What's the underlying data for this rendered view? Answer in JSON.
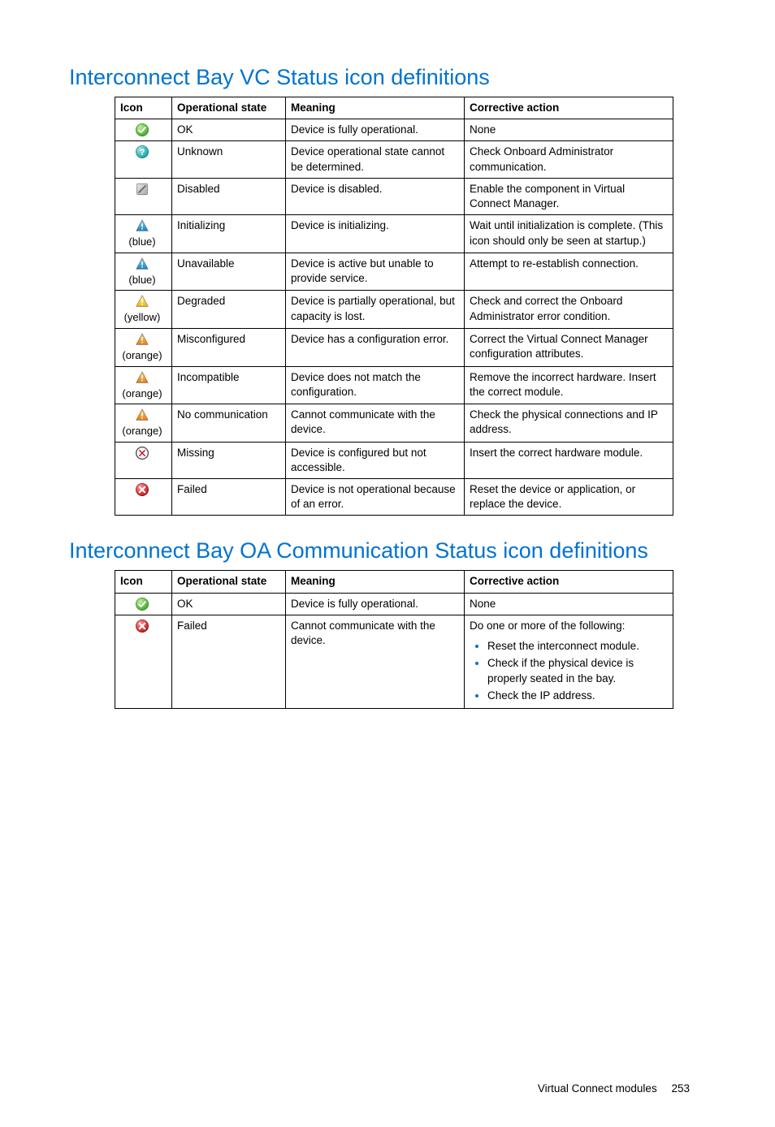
{
  "headings": {
    "vc": "Interconnect Bay VC Status icon definitions",
    "oa": "Interconnect Bay OA Communication Status icon definitions"
  },
  "columns": {
    "icon": "Icon",
    "state": "Operational state",
    "meaning": "Meaning",
    "action": "Corrective action"
  },
  "icon_labels": {
    "blue": "(blue)",
    "yellow": "(yellow)",
    "orange": "(orange)"
  },
  "vc_rows": [
    {
      "icon": "ok",
      "label": "",
      "state": "OK",
      "meaning": "Device is fully operational.",
      "action": "None"
    },
    {
      "icon": "unknown",
      "label": "",
      "state": "Unknown",
      "meaning": "Device operational state cannot be determined.",
      "action": "Check Onboard Administrator communication."
    },
    {
      "icon": "disabled",
      "label": "",
      "state": "Disabled",
      "meaning": "Device is disabled.",
      "action": "Enable the component in Virtual Connect Manager."
    },
    {
      "icon": "warn-blue",
      "label": "blue",
      "state": "Initializing",
      "meaning": "Device is initializing.",
      "action": "Wait until initialization is complete. (This icon should only be seen at startup.)"
    },
    {
      "icon": "warn-blue",
      "label": "blue",
      "state": "Unavailable",
      "meaning": "Device is active but unable to provide service.",
      "action": "Attempt to re-establish connection."
    },
    {
      "icon": "warn-yellow",
      "label": "yellow",
      "state": "Degraded",
      "meaning": "Device is partially operational, but capacity is lost.",
      "action": "Check and correct the Onboard Administrator error condition."
    },
    {
      "icon": "warn-orange",
      "label": "orange",
      "state": "Misconfigured",
      "meaning": "Device has a configuration error.",
      "action": "Correct the Virtual Connect Manager configuration attributes."
    },
    {
      "icon": "warn-orange",
      "label": "orange",
      "state": "Incompatible",
      "meaning": "Device does not match the configuration.",
      "action": "Remove the incorrect hardware. Insert the correct module."
    },
    {
      "icon": "warn-orange",
      "label": "orange",
      "state": "No communication",
      "meaning": "Cannot communicate with the device.",
      "action": "Check the physical connections and IP address."
    },
    {
      "icon": "missing",
      "label": "",
      "state": "Missing",
      "meaning": "Device is configured but not accessible.",
      "action": "Insert the correct hardware module."
    },
    {
      "icon": "failed",
      "label": "",
      "state": "Failed",
      "meaning": "Device is not operational because of an error.",
      "action": "Reset the device or application, or replace the device."
    }
  ],
  "oa_rows": [
    {
      "icon": "ok",
      "label": "",
      "state": "OK",
      "meaning": "Device is fully operational.",
      "action_text": "None",
      "action_list": []
    },
    {
      "icon": "failed",
      "label": "",
      "state": "Failed",
      "meaning": "Cannot communicate with the device.",
      "action_text": "Do one or more of the following:",
      "action_list": [
        "Reset the interconnect module.",
        "Check if the physical device is properly seated in the bay.",
        "Check the IP address."
      ]
    }
  ],
  "footer": {
    "section": "Virtual Connect modules",
    "page": "253"
  }
}
